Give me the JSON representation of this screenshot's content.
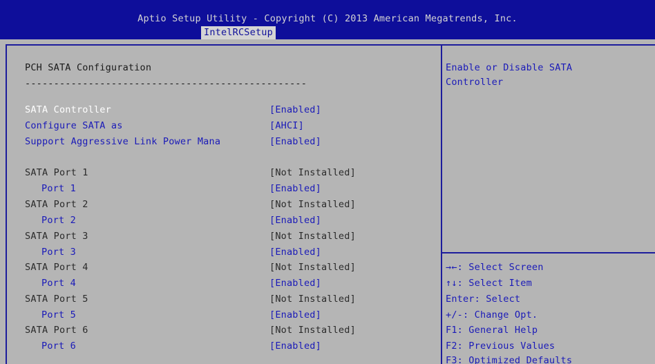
{
  "header": {
    "title": "Aptio Setup Utility - Copyright (C) 2013 American Megatrends, Inc.",
    "tab": "IntelRCSetup"
  },
  "page": {
    "title": "PCH SATA Configuration",
    "separator": "-------------------------------------------------"
  },
  "settings": [
    {
      "label": "SATA Controller",
      "value": "[Enabled]"
    },
    {
      "label": "Configure SATA as",
      "value": "[AHCI]"
    },
    {
      "label": "Support Aggressive Link Power Mana",
      "value": "[Enabled]"
    }
  ],
  "ports": [
    {
      "label": "SATA Port 1",
      "status": "[Not Installed]",
      "sub_label": "Port 1",
      "sub_value": "[Enabled]"
    },
    {
      "label": "SATA Port 2",
      "status": "[Not Installed]",
      "sub_label": "Port 2",
      "sub_value": "[Enabled]"
    },
    {
      "label": "SATA Port 3",
      "status": "[Not Installed]",
      "sub_label": "Port 3",
      "sub_value": "[Enabled]"
    },
    {
      "label": "SATA Port 4",
      "status": "[Not Installed]",
      "sub_label": "Port 4",
      "sub_value": "[Enabled]"
    },
    {
      "label": "SATA Port 5",
      "status": "[Not Installed]",
      "sub_label": "Port 5",
      "sub_value": "[Enabled]"
    },
    {
      "label": "SATA Port 6",
      "status": "[Not Installed]",
      "sub_label": "Port 6",
      "sub_value": "[Enabled]"
    }
  ],
  "help": {
    "line1": "Enable or Disable SATA",
    "line2": "Controller"
  },
  "keys": [
    "→←: Select Screen",
    "↑↓: Select Item",
    "Enter: Select",
    "+/-: Change Opt.",
    "F1: General Help",
    "F2: Previous Values",
    "F3: Optimized Defaults"
  ],
  "colors": {
    "background": "#b5b5b5",
    "header": "#0e0e9a",
    "link": "#1a1ab8",
    "selected": "#ffffff"
  }
}
